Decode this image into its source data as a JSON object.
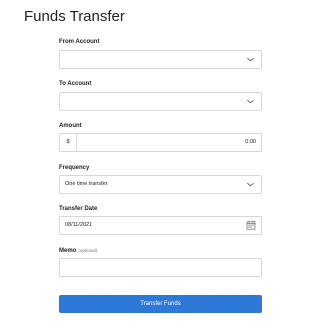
{
  "page": {
    "title": "Funds Transfer"
  },
  "from_account": {
    "label": "From Account",
    "value": ""
  },
  "to_account": {
    "label": "To Account",
    "value": ""
  },
  "amount": {
    "label": "Amount",
    "currency_symbol": "$",
    "value": "0.00"
  },
  "frequency": {
    "label": "Frequency",
    "value": "One time transfer"
  },
  "transfer_date": {
    "label": "Transfer Date",
    "value": "08/11/2021"
  },
  "memo": {
    "label": "Memo",
    "optional_hint": "(optional)",
    "value": ""
  },
  "submit": {
    "label": "Transfer Funds"
  },
  "icons": {
    "select_arrow": "chevron-down-icon",
    "date_picker": "calendar-icon"
  },
  "colors": {
    "primary_button": "#2e78d6",
    "field_border": "#d7d7d7"
  }
}
